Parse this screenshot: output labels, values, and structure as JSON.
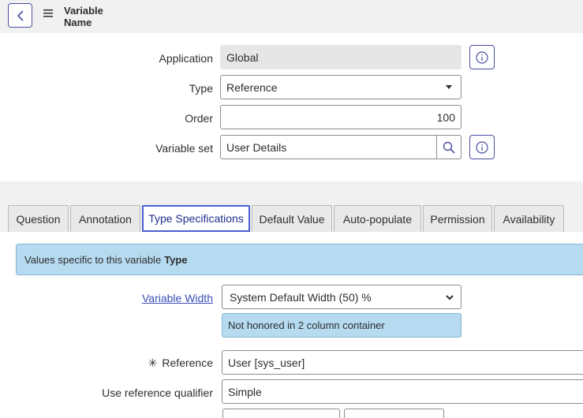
{
  "header": {
    "title": "Variable Name"
  },
  "form": {
    "application": {
      "label": "Application",
      "value": "Global"
    },
    "type": {
      "label": "Type",
      "value": "Reference"
    },
    "order": {
      "label": "Order",
      "value": "100"
    },
    "variable_set": {
      "label": "Variable set",
      "value": "User Details"
    }
  },
  "tabs": [
    {
      "label": "Question"
    },
    {
      "label": "Annotation"
    },
    {
      "label": "Type Specifications",
      "active": true
    },
    {
      "label": "Default Value"
    },
    {
      "label": "Auto-populate"
    },
    {
      "label": "Permission"
    },
    {
      "label": "Availability"
    }
  ],
  "panel": {
    "banner_text": "Values specific to this variable",
    "banner_bold": "Type",
    "variable_width": {
      "label": "Variable Width",
      "value": "System Default Width (50) %"
    },
    "width_note": "Not honored in 2 column container",
    "reference": {
      "label": "Reference",
      "required_mark": "✳",
      "value": "User [sys_user]"
    },
    "qualifier": {
      "label": "Use reference qualifier",
      "value": "Simple"
    }
  },
  "colors": {
    "accent": "#4a5fd0",
    "info_bg": "#b6daf0",
    "header_bg": "#f1f1f1"
  },
  "icons": [
    "back-icon",
    "menu-icon",
    "info-icon",
    "search-icon",
    "caret-down-icon",
    "chevron-down-icon"
  ]
}
